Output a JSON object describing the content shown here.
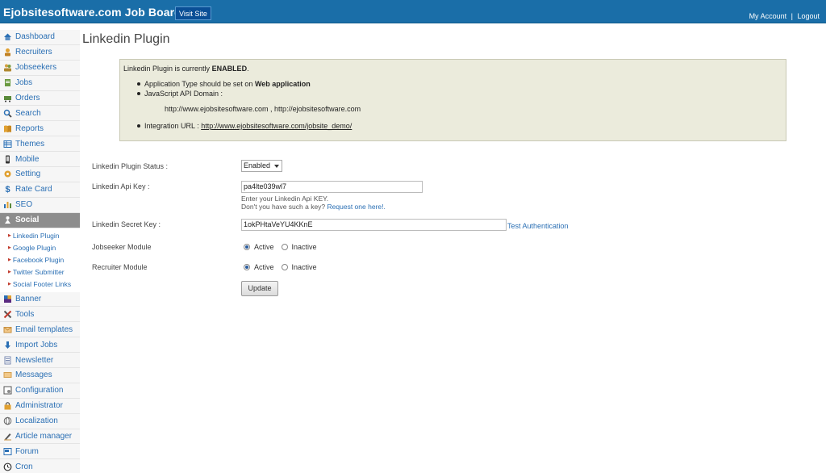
{
  "header": {
    "brand": "Ejobsitesoftware.com Job Board",
    "visit_site": "Visit Site",
    "my_account": "My Account",
    "separator": "|",
    "logout": "Logout"
  },
  "sidebar": {
    "items": [
      {
        "label": "Dashboard",
        "icon": "house-icon"
      },
      {
        "label": "Recruiters",
        "icon": "user-icon"
      },
      {
        "label": "Jobseekers",
        "icon": "users-icon"
      },
      {
        "label": "Jobs",
        "icon": "document-icon"
      },
      {
        "label": "Orders",
        "icon": "cart-icon"
      },
      {
        "label": "Search",
        "icon": "magnifier-icon"
      },
      {
        "label": "Reports",
        "icon": "book-icon"
      },
      {
        "label": "Themes",
        "icon": "grid-icon"
      },
      {
        "label": "Mobile",
        "icon": "phone-icon"
      },
      {
        "label": "Setting",
        "icon": "gear-icon"
      },
      {
        "label": "Rate Card",
        "icon": "dollar-icon"
      },
      {
        "label": "SEO",
        "icon": "bar-chart-icon"
      },
      {
        "label": "Social",
        "icon": "person-icon"
      },
      {
        "label": "Banner",
        "icon": "banner-icon"
      },
      {
        "label": "Tools",
        "icon": "tools-icon"
      },
      {
        "label": "Email templates",
        "icon": "email-icon"
      },
      {
        "label": "Import Jobs",
        "icon": "import-icon"
      },
      {
        "label": "Newsletter",
        "icon": "newsletter-icon"
      },
      {
        "label": "Messages",
        "icon": "message-icon"
      },
      {
        "label": "Configuration",
        "icon": "config-icon"
      },
      {
        "label": "Administrator",
        "icon": "admin-icon"
      },
      {
        "label": "Localization",
        "icon": "globe-icon"
      },
      {
        "label": "Article manager",
        "icon": "pen-icon"
      },
      {
        "label": "Forum",
        "icon": "forum-icon"
      },
      {
        "label": "Cron",
        "icon": "clock-icon"
      }
    ],
    "social_sub": [
      "Linkedin Plugin",
      "Google Plugin",
      "Facebook Plugin",
      "Twitter Submitter",
      "Social Footer Links"
    ]
  },
  "page": {
    "title": "Linkedin Plugin"
  },
  "infobox": {
    "status_prefix": "Linkedin Plugin is currently ",
    "status_value": "ENABLED",
    "status_suffix": ".",
    "app_type_prefix": "Application Type should be set on ",
    "app_type_value": "Web application",
    "js_api_domain": "JavaScript API Domain :",
    "domains": "http://www.ejobsitesoftware.com , http://ejobsitesoftware.com",
    "integration_prefix": "Integration URL : ",
    "integration_url": "http://www.ejobsitesoftware.com/jobsite_demo/"
  },
  "form": {
    "status_label": "Linkedin Plugin Status :",
    "status_value": "Enabled",
    "api_key_label": "Linkedin Api Key :",
    "api_key_value": "pa4lte039wl7",
    "api_help_1": "Enter your Linkedin Api KEY.",
    "api_help_2": "Don't you have such a key? ",
    "api_help_link": "Request one here!.",
    "secret_label": "Linkedin Secret Key :",
    "secret_value": "1okPHtaVeYU4KKnE",
    "test_auth": "Test Authentication",
    "jobseeker_label": "Jobseeker Module",
    "recruiter_label": "Recruiter Module",
    "active": "Active",
    "inactive": "Inactive",
    "update": "Update"
  }
}
